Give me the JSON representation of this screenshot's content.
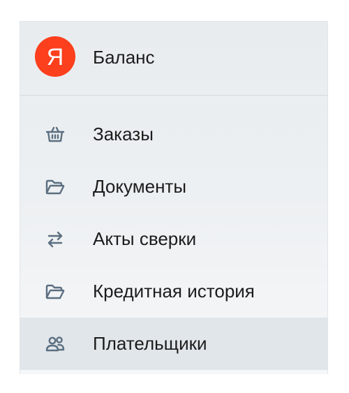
{
  "header": {
    "logo_letter": "Я",
    "label": "Баланс",
    "logo_icon": "yandex-logo-icon",
    "logo_color": "#fc3f1d"
  },
  "menu": {
    "active_index": 4,
    "icon_color": "#5b6f80",
    "items": [
      {
        "label": "Заказы",
        "icon": "basket-icon"
      },
      {
        "label": "Документы",
        "icon": "folder-icon"
      },
      {
        "label": "Акты сверки",
        "icon": "swap-arrows-icon"
      },
      {
        "label": "Кредитная история",
        "icon": "folder-icon"
      },
      {
        "label": "Плательщики",
        "icon": "users-icon"
      }
    ]
  }
}
